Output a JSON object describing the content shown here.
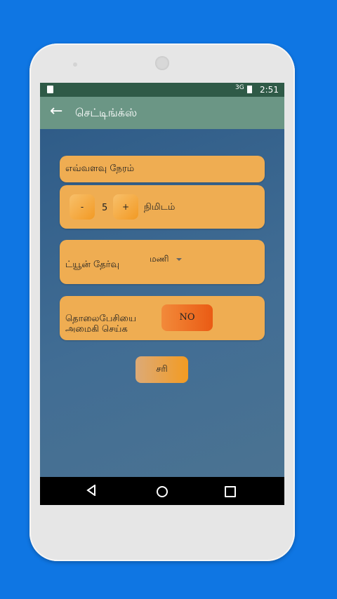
{
  "status_bar": {
    "network": "3G",
    "time": "2:51"
  },
  "app_bar": {
    "back_icon": "arrow-left-icon",
    "title": "செட்டிங்க்ஸ்"
  },
  "duration": {
    "label": "எவ்வளவு நேரம்",
    "minus_label": "-",
    "value": "5",
    "plus_label": "+",
    "unit": "நிமிடம்"
  },
  "tune": {
    "label": "ட்யூன் தேர்வு",
    "selected": "மணி"
  },
  "phone_silent": {
    "label_line1": "தொலைபேசியை",
    "label_line2": "அமைகி செய்க",
    "toggle_value": "NO"
  },
  "ok_button": {
    "label": "சரி"
  },
  "colors": {
    "card": "#efad52",
    "toggle": "#ea5b14",
    "app_bar": "#6b9685",
    "status_bar": "#2f5a47",
    "background": "#0f76e3"
  },
  "nav_bar": {
    "back_icon": "triangle-back-icon",
    "home_icon": "circle-home-icon",
    "recents_icon": "square-recents-icon"
  }
}
